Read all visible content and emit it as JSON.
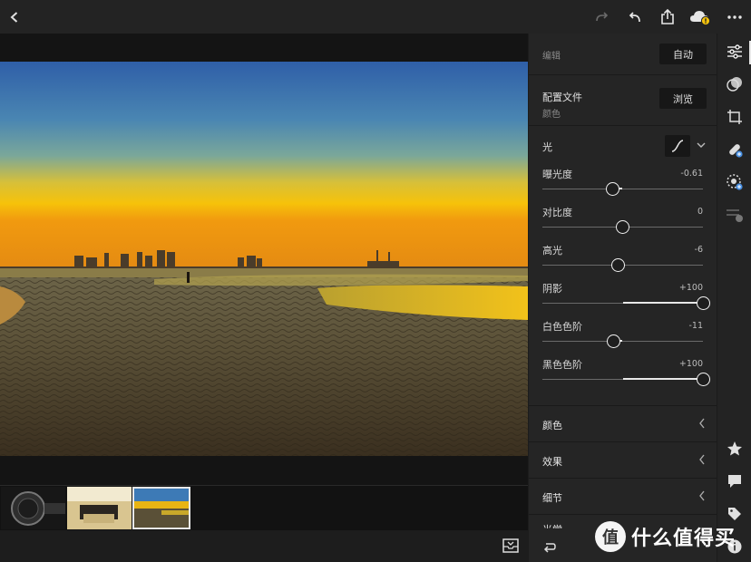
{
  "toolbar": {
    "back_icon": "chevron-left-icon",
    "redo_icon": "redo-icon",
    "undo_icon": "undo-icon",
    "share_icon": "share-icon",
    "cloud_icon": "cloud-warning-icon",
    "more_icon": "more-icon"
  },
  "panel": {
    "edit_label": "编辑",
    "auto_button": "自动",
    "profile_title": "配置文件",
    "profile_value": "颜色",
    "browse_button": "浏览",
    "light_title": "光",
    "sliders": [
      {
        "name": "曝光度",
        "value": "-0.61",
        "level": -0.122
      },
      {
        "name": "对比度",
        "value": "0",
        "level": 0
      },
      {
        "name": "高光",
        "value": "-6",
        "level": -0.06
      },
      {
        "name": "阴影",
        "value": "+100",
        "level": 1.0
      },
      {
        "name": "白色色阶",
        "value": "-11",
        "level": -0.11
      },
      {
        "name": "黑色色阶",
        "value": "+100",
        "level": 1.0
      }
    ],
    "collapsed_sections": [
      "颜色",
      "效果",
      "细节"
    ],
    "partial_section": "光学"
  },
  "watermark": {
    "icon_glyph": "值",
    "text": "什么值得买"
  },
  "colors": {
    "accent": "#4a90e2",
    "warning": "#f4c20d",
    "panel_bg": "#252525"
  }
}
